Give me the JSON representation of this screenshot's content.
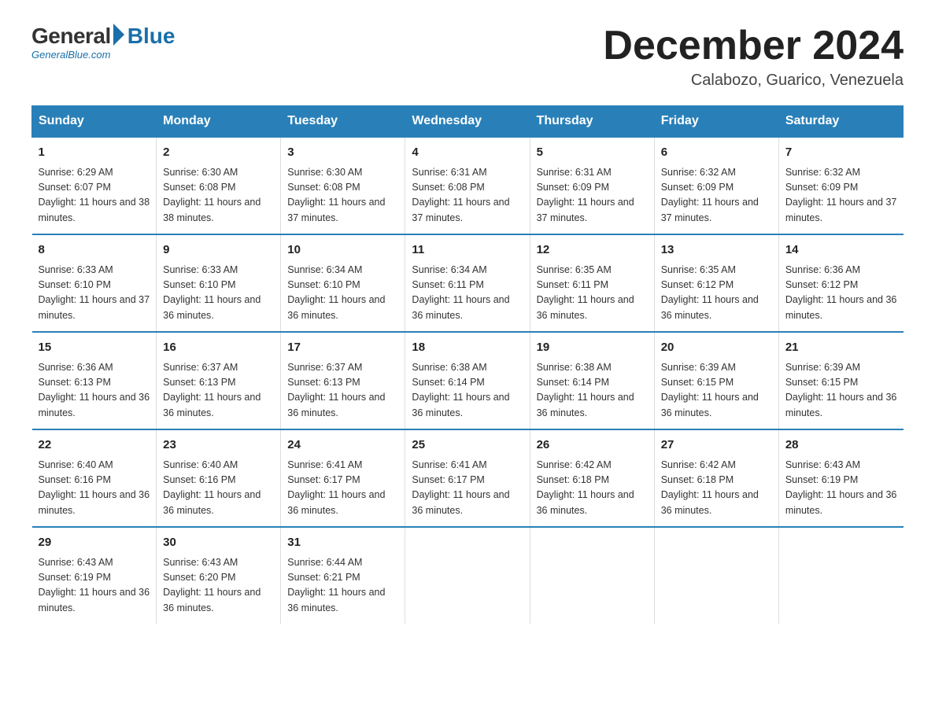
{
  "logo": {
    "general": "General",
    "blue": "Blue",
    "subtitle": "GeneralBlue.com"
  },
  "title": "December 2024",
  "location": "Calabozo, Guarico, Venezuela",
  "days_of_week": [
    "Sunday",
    "Monday",
    "Tuesday",
    "Wednesday",
    "Thursday",
    "Friday",
    "Saturday"
  ],
  "weeks": [
    [
      {
        "day": "1",
        "sunrise": "6:29 AM",
        "sunset": "6:07 PM",
        "daylight": "11 hours and 38 minutes."
      },
      {
        "day": "2",
        "sunrise": "6:30 AM",
        "sunset": "6:08 PM",
        "daylight": "11 hours and 38 minutes."
      },
      {
        "day": "3",
        "sunrise": "6:30 AM",
        "sunset": "6:08 PM",
        "daylight": "11 hours and 37 minutes."
      },
      {
        "day": "4",
        "sunrise": "6:31 AM",
        "sunset": "6:08 PM",
        "daylight": "11 hours and 37 minutes."
      },
      {
        "day": "5",
        "sunrise": "6:31 AM",
        "sunset": "6:09 PM",
        "daylight": "11 hours and 37 minutes."
      },
      {
        "day": "6",
        "sunrise": "6:32 AM",
        "sunset": "6:09 PM",
        "daylight": "11 hours and 37 minutes."
      },
      {
        "day": "7",
        "sunrise": "6:32 AM",
        "sunset": "6:09 PM",
        "daylight": "11 hours and 37 minutes."
      }
    ],
    [
      {
        "day": "8",
        "sunrise": "6:33 AM",
        "sunset": "6:10 PM",
        "daylight": "11 hours and 37 minutes."
      },
      {
        "day": "9",
        "sunrise": "6:33 AM",
        "sunset": "6:10 PM",
        "daylight": "11 hours and 36 minutes."
      },
      {
        "day": "10",
        "sunrise": "6:34 AM",
        "sunset": "6:10 PM",
        "daylight": "11 hours and 36 minutes."
      },
      {
        "day": "11",
        "sunrise": "6:34 AM",
        "sunset": "6:11 PM",
        "daylight": "11 hours and 36 minutes."
      },
      {
        "day": "12",
        "sunrise": "6:35 AM",
        "sunset": "6:11 PM",
        "daylight": "11 hours and 36 minutes."
      },
      {
        "day": "13",
        "sunrise": "6:35 AM",
        "sunset": "6:12 PM",
        "daylight": "11 hours and 36 minutes."
      },
      {
        "day": "14",
        "sunrise": "6:36 AM",
        "sunset": "6:12 PM",
        "daylight": "11 hours and 36 minutes."
      }
    ],
    [
      {
        "day": "15",
        "sunrise": "6:36 AM",
        "sunset": "6:13 PM",
        "daylight": "11 hours and 36 minutes."
      },
      {
        "day": "16",
        "sunrise": "6:37 AM",
        "sunset": "6:13 PM",
        "daylight": "11 hours and 36 minutes."
      },
      {
        "day": "17",
        "sunrise": "6:37 AM",
        "sunset": "6:13 PM",
        "daylight": "11 hours and 36 minutes."
      },
      {
        "day": "18",
        "sunrise": "6:38 AM",
        "sunset": "6:14 PM",
        "daylight": "11 hours and 36 minutes."
      },
      {
        "day": "19",
        "sunrise": "6:38 AM",
        "sunset": "6:14 PM",
        "daylight": "11 hours and 36 minutes."
      },
      {
        "day": "20",
        "sunrise": "6:39 AM",
        "sunset": "6:15 PM",
        "daylight": "11 hours and 36 minutes."
      },
      {
        "day": "21",
        "sunrise": "6:39 AM",
        "sunset": "6:15 PM",
        "daylight": "11 hours and 36 minutes."
      }
    ],
    [
      {
        "day": "22",
        "sunrise": "6:40 AM",
        "sunset": "6:16 PM",
        "daylight": "11 hours and 36 minutes."
      },
      {
        "day": "23",
        "sunrise": "6:40 AM",
        "sunset": "6:16 PM",
        "daylight": "11 hours and 36 minutes."
      },
      {
        "day": "24",
        "sunrise": "6:41 AM",
        "sunset": "6:17 PM",
        "daylight": "11 hours and 36 minutes."
      },
      {
        "day": "25",
        "sunrise": "6:41 AM",
        "sunset": "6:17 PM",
        "daylight": "11 hours and 36 minutes."
      },
      {
        "day": "26",
        "sunrise": "6:42 AM",
        "sunset": "6:18 PM",
        "daylight": "11 hours and 36 minutes."
      },
      {
        "day": "27",
        "sunrise": "6:42 AM",
        "sunset": "6:18 PM",
        "daylight": "11 hours and 36 minutes."
      },
      {
        "day": "28",
        "sunrise": "6:43 AM",
        "sunset": "6:19 PM",
        "daylight": "11 hours and 36 minutes."
      }
    ],
    [
      {
        "day": "29",
        "sunrise": "6:43 AM",
        "sunset": "6:19 PM",
        "daylight": "11 hours and 36 minutes."
      },
      {
        "day": "30",
        "sunrise": "6:43 AM",
        "sunset": "6:20 PM",
        "daylight": "11 hours and 36 minutes."
      },
      {
        "day": "31",
        "sunrise": "6:44 AM",
        "sunset": "6:21 PM",
        "daylight": "11 hours and 36 minutes."
      },
      null,
      null,
      null,
      null
    ]
  ],
  "accent_color": "#2980b9"
}
